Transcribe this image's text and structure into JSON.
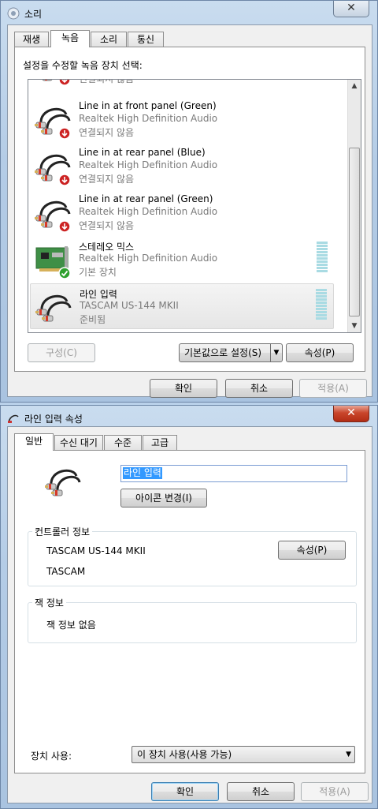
{
  "window1": {
    "title": "소리",
    "close": "✕",
    "tabs": [
      "재생",
      "녹음",
      "소리",
      "통신"
    ],
    "instruction": "설정을 수정할 녹음 장치 선택:",
    "devices": [
      {
        "name": "",
        "driver": "",
        "status": "연결되지 않음",
        "icon": "line-in-cable-icon",
        "state": "disconnected"
      },
      {
        "name": "Line in at front panel (Green)",
        "driver": "Realtek High Definition Audio",
        "status": "연결되지 않음",
        "icon": "line-in-cable-icon",
        "state": "disconnected"
      },
      {
        "name": "Line in at rear panel (Blue)",
        "driver": "Realtek High Definition Audio",
        "status": "연결되지 않음",
        "icon": "line-in-cable-icon",
        "state": "disconnected"
      },
      {
        "name": "Line in at rear panel (Green)",
        "driver": "Realtek High Definition Audio",
        "status": "연결되지 않음",
        "icon": "line-in-cable-icon",
        "state": "disconnected"
      },
      {
        "name": "스테레오 믹스",
        "driver": "Realtek High Definition Audio",
        "status": "기본 장치",
        "icon": "sound-card-icon",
        "state": "default"
      },
      {
        "name": "라인 입력",
        "driver": "TASCAM US-144 MKII",
        "status": "준비됨",
        "icon": "line-in-cable-icon",
        "state": "ready"
      }
    ],
    "configure_btn": "구성(C)",
    "set_default_btn": "기본값으로 설정(S)",
    "properties_btn": "속성(P)",
    "ok_btn": "확인",
    "cancel_btn": "취소",
    "apply_btn": "적용(A)"
  },
  "window2": {
    "title": "라인 입력 속성",
    "close": "✕",
    "tabs": [
      "일반",
      "수신 대기",
      "수준",
      "고급"
    ],
    "device_name_value": "라인 입력",
    "change_icon_btn": "아이콘 변경(I)",
    "controller_group": "컨트롤러 정보",
    "controller_name": "TASCAM US-144 MKII",
    "controller_vendor": "TASCAM",
    "controller_properties_btn": "속성(P)",
    "jack_group": "잭 정보",
    "jack_info": "잭 정보 없음",
    "device_usage_label": "장치 사용:",
    "device_usage_value": "이 장치 사용(사용 가능)",
    "ok_btn": "확인",
    "cancel_btn": "취소",
    "apply_btn": "적용(A)"
  }
}
